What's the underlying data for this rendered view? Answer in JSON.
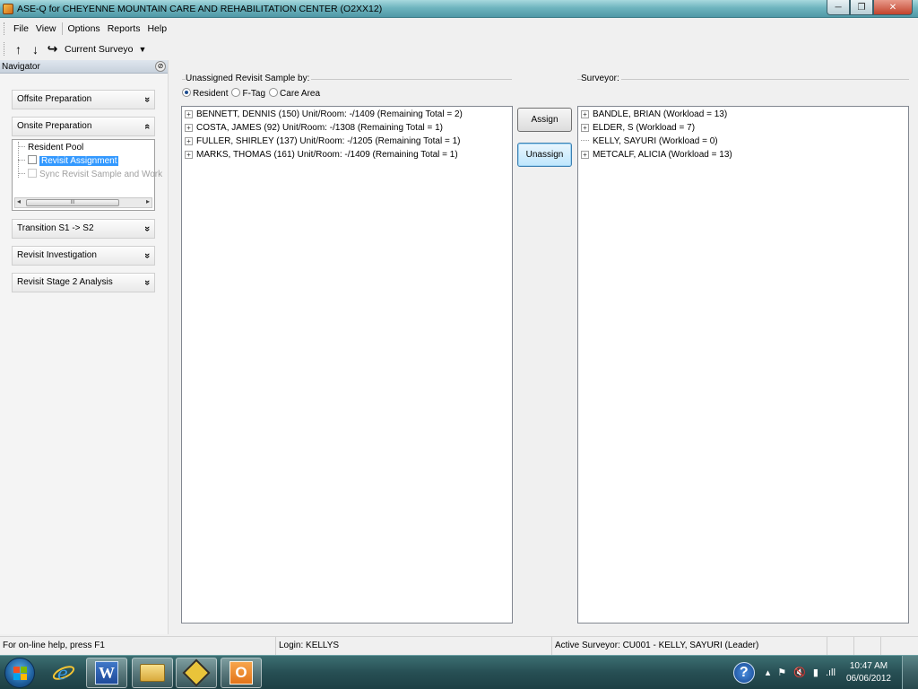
{
  "window": {
    "title": "ASE-Q for CHEYENNE MOUNTAIN CARE AND REHABILITATION CENTER (O2XX12)",
    "controls": {
      "minimize": "─",
      "maximize": "❐",
      "close": "✕"
    }
  },
  "menu": {
    "items": [
      "File",
      "View",
      "Options",
      "Reports",
      "Help"
    ]
  },
  "toolbar": {
    "up_icon": "↑",
    "down_icon": "↓",
    "redo_icon": "↪",
    "current_surveyor_label": "Current Surveyo",
    "dropdown_icon": "▼"
  },
  "navigator": {
    "header": "Navigator",
    "pin_icon": "⊘",
    "sections": [
      {
        "label": "Offsite Preparation",
        "chevron": "»"
      },
      {
        "label": "Onsite Preparation",
        "chevron": "«"
      },
      {
        "label": "Transition S1 -> S2",
        "chevron": "»"
      },
      {
        "label": "Revisit Investigation",
        "chevron": "»"
      },
      {
        "label": "Revisit Stage 2 Analysis",
        "chevron": "»"
      }
    ],
    "tree": {
      "root": "Resident Pool",
      "items": [
        {
          "label": "Revisit Assignment",
          "selected": true,
          "enabled": true
        },
        {
          "label": "Sync Revisit Sample and Work",
          "selected": false,
          "enabled": false
        }
      ],
      "scroll_left": "◂",
      "scroll_right": "▸",
      "scroll_thumb": "III"
    }
  },
  "unassigned": {
    "group_label": "Unassigned Revisit Sample by:",
    "options": [
      {
        "label": "Resident",
        "checked": true
      },
      {
        "label": "F-Tag",
        "checked": false
      },
      {
        "label": "Care Area",
        "checked": false
      }
    ],
    "items": [
      "BENNETT, DENNIS (150) Unit/Room: -/1409 (Remaining Total = 2)",
      "COSTA, JAMES (92) Unit/Room: -/1308 (Remaining Total = 1)",
      "FULLER, SHIRLEY (137) Unit/Room: -/1205 (Remaining Total = 1)",
      "MARKS, THOMAS (161) Unit/Room: -/1409 (Remaining Total = 1)"
    ],
    "expander_icon": "+"
  },
  "actions": {
    "assign": "Assign",
    "unassign": "Unassign"
  },
  "surveyor": {
    "group_label": "Surveyor:",
    "items": [
      {
        "label": "BANDLE, BRIAN  (Workload = 13)",
        "expandable": true
      },
      {
        "label": "ELDER, S  (Workload = 7)",
        "expandable": true
      },
      {
        "label": "KELLY, SAYURI  (Workload = 0)",
        "expandable": false
      },
      {
        "label": "METCALF, ALICIA  (Workload = 13)",
        "expandable": true
      }
    ],
    "expander_icon": "+"
  },
  "status": {
    "help": "For on-line help, press F1",
    "login": "Login: KELLYS",
    "active_surveyor": "Active Surveyor: CU001 - KELLY, SAYURI  (Leader)"
  },
  "taskbar": {
    "apps": [
      "ie-icon",
      "word-icon",
      "explorer-icon",
      "ase-icon",
      "outlook-icon"
    ],
    "word_letter": "W",
    "outlook_letter": "O",
    "ie_letter": "e",
    "help_icon": "?",
    "tray_icons": {
      "up": "▴",
      "flag": "⚑",
      "volume": "🔇",
      "power": "▮",
      "signal": ".ıll"
    },
    "time": "10:47 AM",
    "date": "06/06/2012"
  },
  "colors": {
    "selection": "#3399ff",
    "title_bar": "#6fb5bf",
    "taskbar": "#274f54"
  }
}
